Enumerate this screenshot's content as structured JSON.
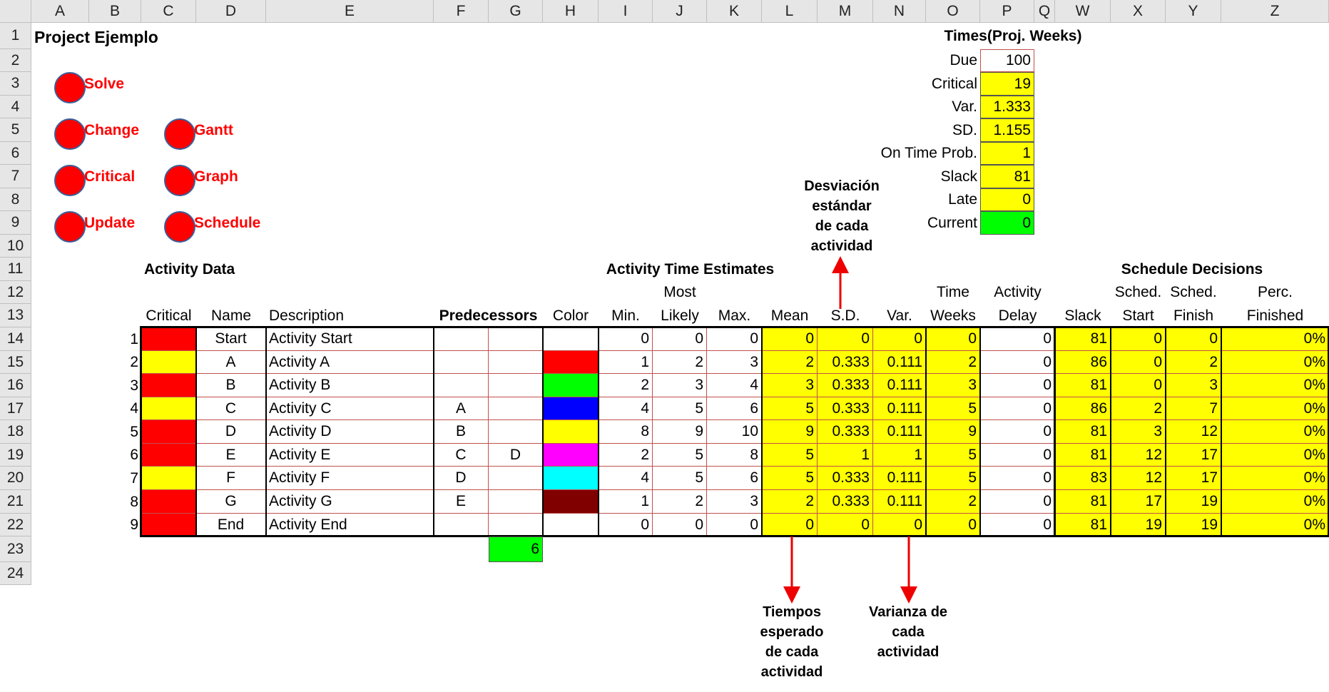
{
  "columns": [
    "A",
    "B",
    "C",
    "D",
    "E",
    "F",
    "G",
    "H",
    "I",
    "J",
    "K",
    "L",
    "M",
    "N",
    "O",
    "P",
    "Q",
    "W",
    "X",
    "Y",
    "Z"
  ],
  "rows": [
    "1",
    "2",
    "3",
    "4",
    "5",
    "6",
    "7",
    "8",
    "9",
    "10",
    "11",
    "12",
    "13",
    "14",
    "15",
    "16",
    "17",
    "18",
    "19",
    "20",
    "21",
    "22",
    "23",
    "24"
  ],
  "title": "Project Ejemplo",
  "buttons": {
    "solve": "Solve",
    "change": "Change",
    "critical": "Critical",
    "update": "Update",
    "gantt": "Gantt",
    "graph": "Graph",
    "schedule": "Schedule"
  },
  "times": {
    "header": "Times(Proj. Weeks)",
    "labels": [
      "Due",
      "Critical",
      "Var.",
      "SD.",
      "On Time Prob.",
      "Slack",
      "Late",
      "Current"
    ],
    "values": [
      "100",
      "19",
      "1.333",
      "1.155",
      "1",
      "81",
      "0",
      "0"
    ]
  },
  "sections": {
    "activity_data": "Activity Data",
    "time_estimates": "Activity Time Estimates",
    "schedule_decisions": "Schedule Decisions"
  },
  "headers": {
    "critical": "Critical",
    "name": "Name",
    "description": "Description",
    "predecessors": "Predecessors",
    "color": "Color",
    "min": "Min.",
    "most_1": "Most",
    "most_2": "Likely",
    "max": "Max.",
    "mean": "Mean",
    "sd": "S.D.",
    "var": "Var.",
    "time_1": "Time",
    "time_2": "Weeks",
    "delay_1": "Activity",
    "delay_2": "Delay",
    "slack": "Slack",
    "start_1": "Sched.",
    "start_2": "Start",
    "finish_1": "Sched.",
    "finish_2": "Finish",
    "perc_1": "Perc.",
    "perc_2": "Finished"
  },
  "colors": {
    "red": "#ff0000",
    "yellow": "#ffff00",
    "green": "#00ff00",
    "blue": "#0000ff",
    "magenta": "#ff00ff",
    "cyan": "#00ffff",
    "maroon": "#800000",
    "grid": "#c0504d"
  },
  "activities": [
    {
      "n": "1",
      "crit": "red",
      "name": "Start",
      "desc": "Activity Start",
      "p1": "",
      "p2": "",
      "color": "white",
      "min": "0",
      "ml": "0",
      "max": "0",
      "mean": "0",
      "sd": "0",
      "var": "0",
      "tw": "0",
      "delay": "0",
      "slack": "81",
      "ss": "0",
      "sf": "0",
      "perc": "0%"
    },
    {
      "n": "2",
      "crit": "yellow",
      "name": "A",
      "desc": "Activity A",
      "p1": "",
      "p2": "",
      "color": "red",
      "min": "1",
      "ml": "2",
      "max": "3",
      "mean": "2",
      "sd": "0.333",
      "var": "0.111",
      "tw": "2",
      "delay": "0",
      "slack": "86",
      "ss": "0",
      "sf": "2",
      "perc": "0%"
    },
    {
      "n": "3",
      "crit": "red",
      "name": "B",
      "desc": "Activity B",
      "p1": "",
      "p2": "",
      "color": "green",
      "min": "2",
      "ml": "3",
      "max": "4",
      "mean": "3",
      "sd": "0.333",
      "var": "0.111",
      "tw": "3",
      "delay": "0",
      "slack": "81",
      "ss": "0",
      "sf": "3",
      "perc": "0%"
    },
    {
      "n": "4",
      "crit": "yellow",
      "name": "C",
      "desc": "Activity C",
      "p1": "A",
      "p2": "",
      "color": "blue",
      "min": "4",
      "ml": "5",
      "max": "6",
      "mean": "5",
      "sd": "0.333",
      "var": "0.111",
      "tw": "5",
      "delay": "0",
      "slack": "86",
      "ss": "2",
      "sf": "7",
      "perc": "0%"
    },
    {
      "n": "5",
      "crit": "red",
      "name": "D",
      "desc": "Activity D",
      "p1": "B",
      "p2": "",
      "color": "yellow",
      "min": "8",
      "ml": "9",
      "max": "10",
      "mean": "9",
      "sd": "0.333",
      "var": "0.111",
      "tw": "9",
      "delay": "0",
      "slack": "81",
      "ss": "3",
      "sf": "12",
      "perc": "0%"
    },
    {
      "n": "6",
      "crit": "red",
      "name": "E",
      "desc": "Activity E",
      "p1": "C",
      "p2": "D",
      "color": "magenta",
      "min": "2",
      "ml": "5",
      "max": "8",
      "mean": "5",
      "sd": "1",
      "var": "1",
      "tw": "5",
      "delay": "0",
      "slack": "81",
      "ss": "12",
      "sf": "17",
      "perc": "0%"
    },
    {
      "n": "7",
      "crit": "yellow",
      "name": "F",
      "desc": "Activity F",
      "p1": "D",
      "p2": "",
      "color": "cyan",
      "min": "4",
      "ml": "5",
      "max": "6",
      "mean": "5",
      "sd": "0.333",
      "var": "0.111",
      "tw": "5",
      "delay": "0",
      "slack": "83",
      "ss": "12",
      "sf": "17",
      "perc": "0%"
    },
    {
      "n": "8",
      "crit": "red",
      "name": "G",
      "desc": "Activity G",
      "p1": "E",
      "p2": "",
      "color": "maroon",
      "min": "1",
      "ml": "2",
      "max": "3",
      "mean": "2",
      "sd": "0.333",
      "var": "0.111",
      "tw": "2",
      "delay": "0",
      "slack": "81",
      "ss": "17",
      "sf": "19",
      "perc": "0%"
    },
    {
      "n": "9",
      "crit": "red",
      "name": "End",
      "desc": "Activity End",
      "p1": "",
      "p2": "",
      "color": "white",
      "min": "0",
      "ml": "0",
      "max": "0",
      "mean": "0",
      "sd": "0",
      "var": "0",
      "tw": "0",
      "delay": "0",
      "slack": "81",
      "ss": "19",
      "sf": "19",
      "perc": "0%"
    }
  ],
  "pred_count": "6",
  "annotations": {
    "sd_note": [
      "Desviación",
      "estándar",
      "de cada",
      "actividad"
    ],
    "mean_note": [
      "Tiempos",
      "esperado",
      "de cada",
      "actividad"
    ],
    "var_note": [
      "Varianza de",
      "cada",
      "actividad"
    ]
  }
}
